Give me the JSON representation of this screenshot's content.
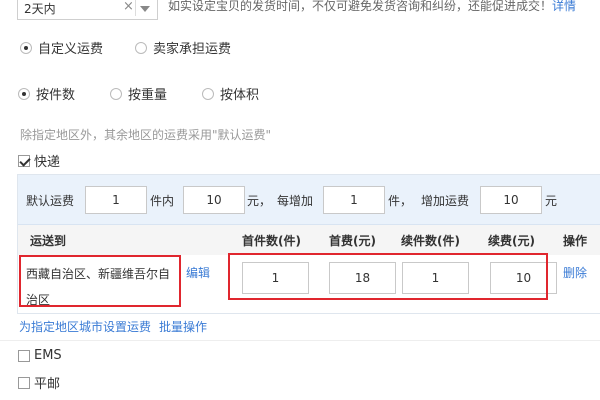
{
  "delivery": {
    "selected": "2天内",
    "clear_glyph": "×",
    "hint": "如实设定宝贝的发货时间，不仅可避免发货咨询和纠纷，还能促进成交！",
    "hint_link": "详情"
  },
  "fee_mode": {
    "options": [
      {
        "label": "自定义运费",
        "selected": true
      },
      {
        "label": "卖家承担运费",
        "selected": false
      }
    ]
  },
  "pricing_basis": {
    "options": [
      {
        "label": "按件数",
        "selected": true
      },
      {
        "label": "按重量",
        "selected": false
      },
      {
        "label": "按体积",
        "selected": false
      }
    ]
  },
  "note": "除指定地区外，其余地区的运费采用\"默认运费\"",
  "express": {
    "label": "快递",
    "checked": true
  },
  "default_fee": {
    "label": "默认运费",
    "first_count": "1",
    "unit_within": "件内",
    "first_fee": "10",
    "unit_yuan": "元，",
    "each_add_label": "每增加",
    "add_count": "1",
    "unit_piece": "件，",
    "add_fee_label": "增加运费",
    "add_fee": "10",
    "unit_yuan_end": "元"
  },
  "table": {
    "headers": [
      "运送到",
      "首件数(件)",
      "首费(元)",
      "续件数(件)",
      "续费(元)",
      "操作"
    ],
    "row": {
      "region": "西藏自治区、新疆维吾尔自治区",
      "edit": "编辑",
      "first_count": "1",
      "first_fee": "18",
      "add_count": "1",
      "add_fee": "10",
      "delete": "删除"
    }
  },
  "actions": {
    "set_city_fee": "为指定地区城市设置运费",
    "batch": "批量操作"
  },
  "others": [
    {
      "label": "EMS",
      "checked": false
    },
    {
      "label": "平邮",
      "checked": false
    }
  ],
  "colors": {
    "link": "#3a7bd5",
    "highlight": "#e0262e",
    "header_bg": "#eaf2fb"
  }
}
